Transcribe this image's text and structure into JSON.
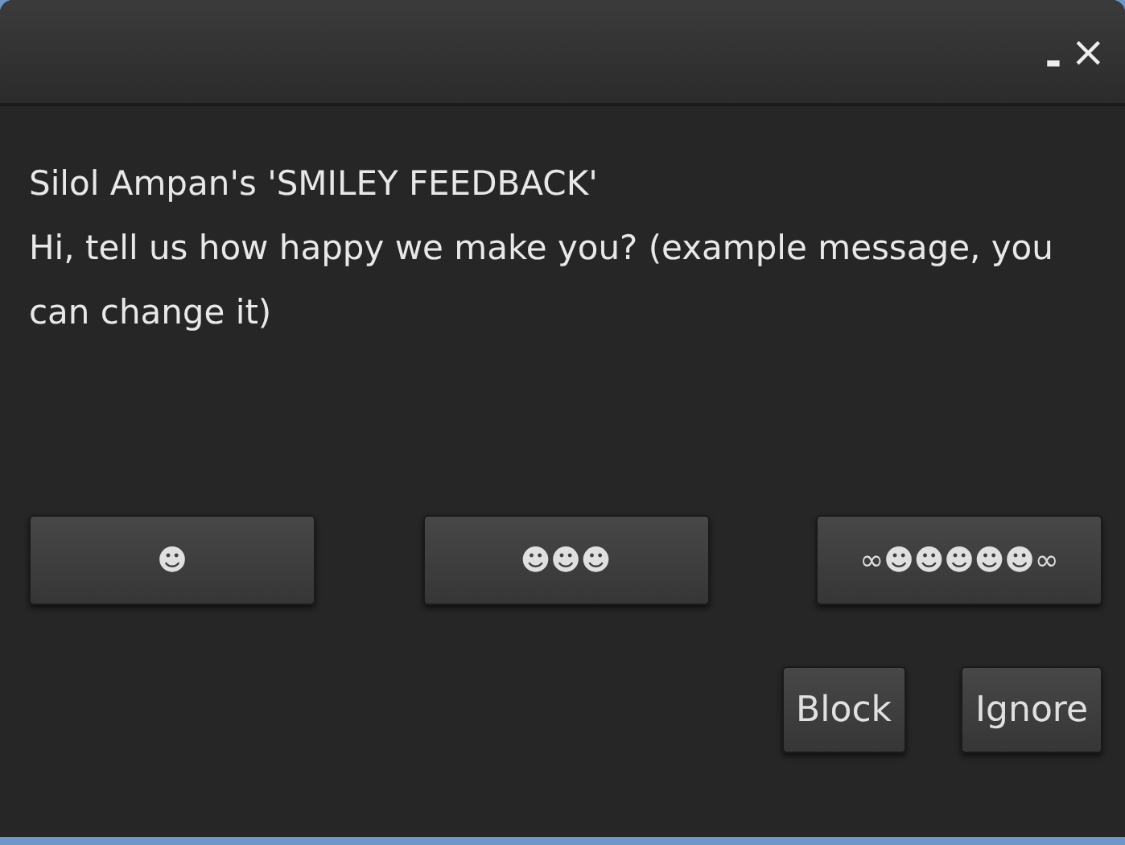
{
  "window": {
    "minimize": "▬",
    "close": "×"
  },
  "message": {
    "title": "Silol Ampan's 'SMILEY FEEDBACK'",
    "body": "Hi, tell us how happy we make you? (example message, you can change it)"
  },
  "choices": [
    "☻",
    "☻☻☻",
    "∞☻☻☻☻☻∞"
  ],
  "actions": [
    "Block",
    "Ignore"
  ]
}
